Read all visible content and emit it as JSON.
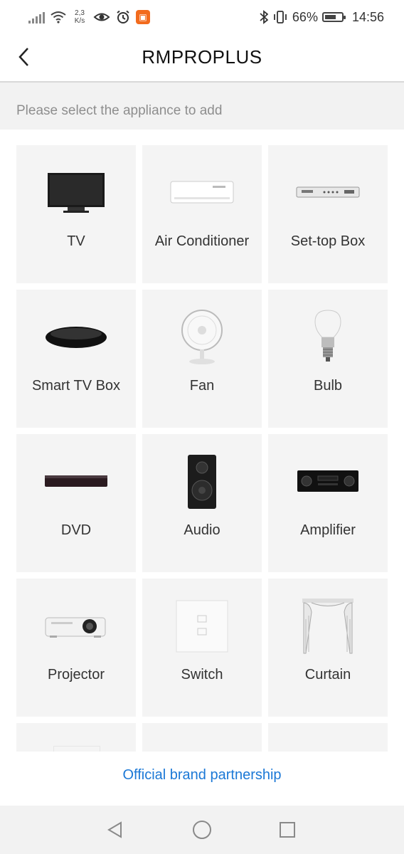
{
  "status_bar": {
    "net_speed_value": "2,3",
    "net_speed_unit": "K/s",
    "battery": "66%",
    "battery_level": 0.66,
    "time": "14:56",
    "icons": [
      "signal-icon",
      "wifi-icon",
      "eye-icon",
      "alarm-icon",
      "app-notification-icon",
      "bluetooth-icon",
      "vibrate-icon",
      "battery-icon"
    ]
  },
  "header": {
    "title": "RMPROPLUS",
    "back_icon": "chevron-left-icon"
  },
  "subtitle": "Please select the appliance to add",
  "appliances": [
    {
      "label": "TV",
      "icon": "tv-icon"
    },
    {
      "label": "Air Conditioner",
      "icon": "air-conditioner-icon"
    },
    {
      "label": "Set-top Box",
      "icon": "set-top-box-icon"
    },
    {
      "label": "Smart TV Box",
      "icon": "smart-tv-box-icon"
    },
    {
      "label": "Fan",
      "icon": "fan-icon"
    },
    {
      "label": "Bulb",
      "icon": "bulb-icon"
    },
    {
      "label": "DVD",
      "icon": "dvd-icon"
    },
    {
      "label": "Audio",
      "icon": "speaker-icon"
    },
    {
      "label": "Amplifier",
      "icon": "amplifier-icon"
    },
    {
      "label": "Projector",
      "icon": "projector-icon"
    },
    {
      "label": "Switch",
      "icon": "switch-icon"
    },
    {
      "label": "Curtain",
      "icon": "curtain-icon"
    }
  ],
  "footer": {
    "link": "Official brand partnership",
    "link_color": "#1b78d6"
  },
  "nav_bar": {
    "icons": [
      "back-triangle-icon",
      "home-circle-icon",
      "recents-square-icon"
    ]
  }
}
